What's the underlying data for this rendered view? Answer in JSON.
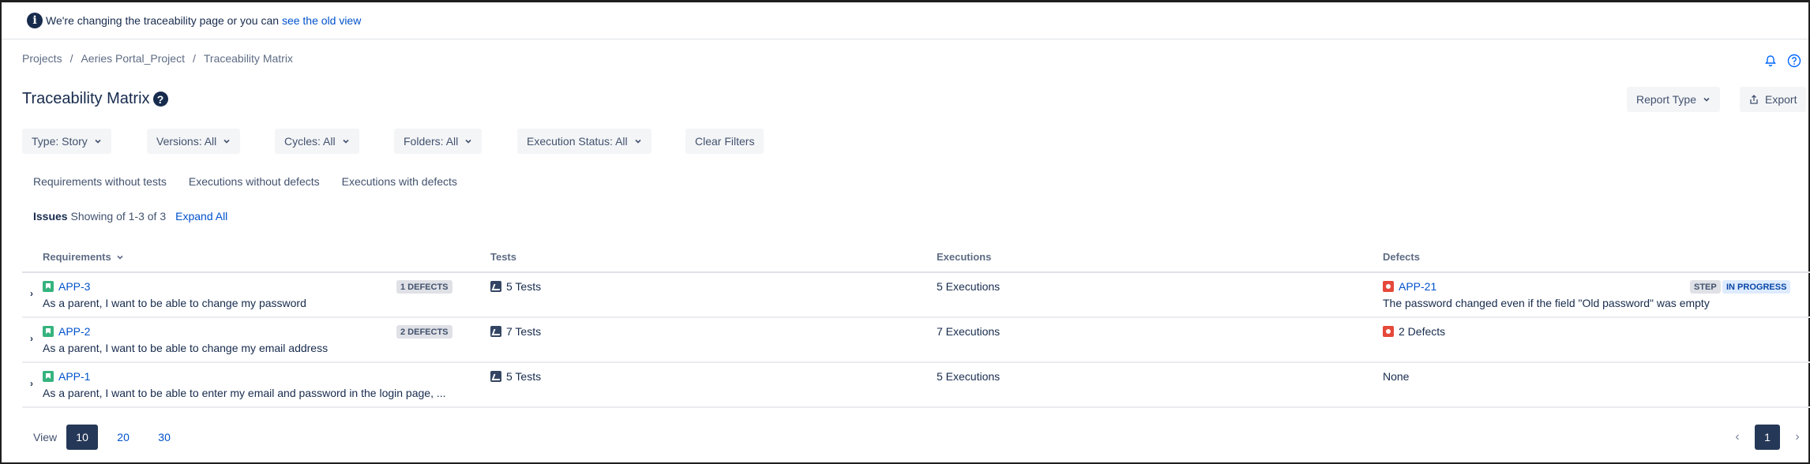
{
  "banner": {
    "text": "We're changing the traceability page or you can",
    "link": "see the old view"
  },
  "breadcrumb": [
    "Projects",
    "Aeries Portal_Project",
    "Traceability Matrix"
  ],
  "page_title": "Traceability Matrix",
  "header_actions": {
    "report_type": "Report Type",
    "export": "Export"
  },
  "filters": {
    "type": "Type: Story",
    "versions": "Versions: All",
    "cycles": "Cycles: All",
    "folders": "Folders: All",
    "execution_status": "Execution Status: All",
    "clear": "Clear Filters"
  },
  "quick_filters": [
    "Requirements without tests",
    "Executions without defects",
    "Executions with defects"
  ],
  "issues": {
    "label": "Issues",
    "showing": "Showing of 1-3 of 3",
    "expand_all": "Expand All"
  },
  "columns": {
    "requirements": "Requirements",
    "tests": "Tests",
    "executions": "Executions",
    "defects": "Defects"
  },
  "rows": [
    {
      "key": "APP-3",
      "summary": "As a parent, I want to be able to change my password",
      "defects_badge": "1 DEFECTS",
      "tests": "5 Tests",
      "executions": "5 Executions",
      "defect_key": "APP-21",
      "defect_summary": "The password changed even if the field \"Old password\" was empty",
      "defect_type": "STEP",
      "defect_status": "IN PROGRESS"
    },
    {
      "key": "APP-2",
      "summary": "As a parent, I want to be able to change my email address",
      "defects_badge": "2 DEFECTS",
      "tests": "7 Tests",
      "executions": "7 Executions",
      "defect_text": "2 Defects"
    },
    {
      "key": "APP-1",
      "summary": "As a parent, I want to be able to enter my email and password in the login page, ...",
      "tests": "5 Tests",
      "executions": "5 Executions",
      "defect_text": "None"
    }
  ],
  "pagination": {
    "view_label": "View",
    "sizes": [
      "10",
      "20",
      "30"
    ],
    "current_page": "1"
  }
}
